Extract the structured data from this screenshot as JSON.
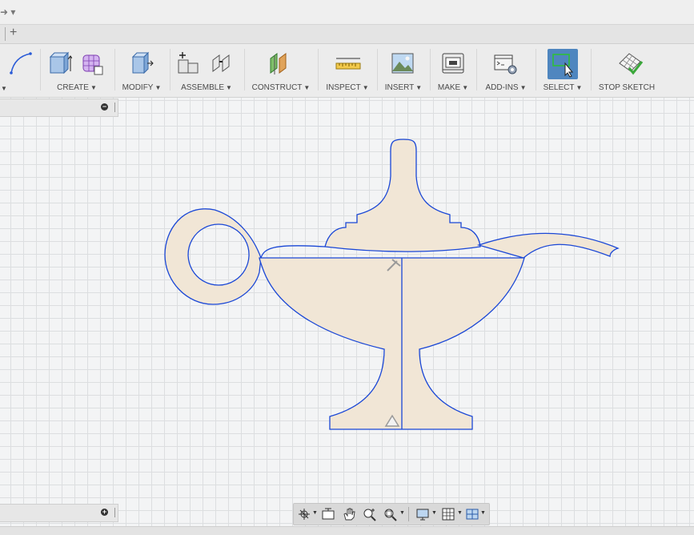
{
  "toolbar": {
    "create_label": "CREATE",
    "modify_label": "MODIFY",
    "assemble_label": "ASSEMBLE",
    "construct_label": "CONSTRUCT",
    "inspect_label": "INSPECT",
    "insert_label": "INSERT",
    "make_label": "MAKE",
    "addins_label": "ADD-INS",
    "select_label": "SELECT",
    "stop_sketch_label": "STOP SKETCH",
    "caret": "▼"
  },
  "tabs": {
    "new_tab": "+"
  },
  "top": {
    "redo_glyph": "➜ ▾"
  },
  "panels": {
    "browser_toggle": "−",
    "comments_toggle": "+"
  },
  "colors": {
    "sketch_line": "#1a47d6",
    "profile_fill": "#f1e6d6",
    "canvas": "#f3f4f5"
  },
  "icons": [
    "redo-icon",
    "sketch-arc-icon",
    "extrude-icon",
    "form-icon",
    "press-pull-icon",
    "new-component-icon",
    "joint-icon",
    "plane-icon",
    "measure-icon",
    "insert-image-icon",
    "print-icon",
    "scripts-icon",
    "select-icon",
    "stop-sketch-icon",
    "orbit-icon",
    "look-at-icon",
    "pan-icon",
    "zoom-icon",
    "fit-icon",
    "display-icon",
    "grid-icon",
    "viewports-icon"
  ]
}
